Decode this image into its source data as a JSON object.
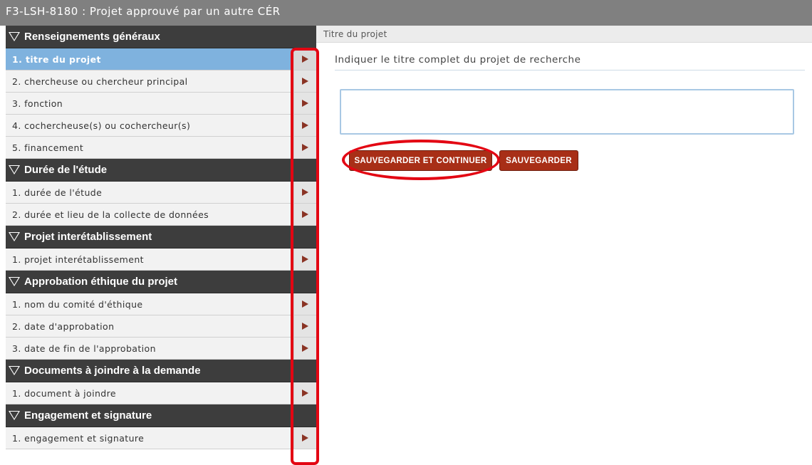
{
  "window": {
    "title": "F3-LSH-8180 : Projet approuvé par un autre CÉR"
  },
  "sidebar": {
    "sections": [
      {
        "title": "Renseignements généraux",
        "items": [
          {
            "label": "1. titre du projet",
            "active": true
          },
          {
            "label": "2. chercheuse ou chercheur principal"
          },
          {
            "label": "3. fonction"
          },
          {
            "label": "4. cochercheuse(s) ou cochercheur(s)"
          },
          {
            "label": "5. financement"
          }
        ]
      },
      {
        "title": "Durée de l'étude",
        "items": [
          {
            "label": "1. durée de l'étude"
          },
          {
            "label": "2. durée et lieu de la collecte de données"
          }
        ]
      },
      {
        "title": "Projet interétablissement",
        "items": [
          {
            "label": "1. projet interétablissement"
          }
        ]
      },
      {
        "title": "Approbation éthique du projet",
        "items": [
          {
            "label": "1. nom du comité d'éthique"
          },
          {
            "label": "2. date d'approbation"
          },
          {
            "label": "3. date de fin de l'approbation"
          }
        ]
      },
      {
        "title": "Documents à joindre à la demande",
        "items": [
          {
            "label": "1. document à joindre"
          }
        ]
      },
      {
        "title": "Engagement et signature",
        "items": [
          {
            "label": "1. engagement et signature"
          }
        ]
      }
    ]
  },
  "content": {
    "header": "Titre du projet",
    "question": "Indiquer le titre complet du projet de recherche",
    "input_value": "",
    "buttons": {
      "save_continue": "SAUVEGARDER ET CONTINUER",
      "save": "SAUVEGARDER"
    }
  },
  "colors": {
    "titlebar": "#808080",
    "section_header": "#3d3d3d",
    "active_item": "#7fb2de",
    "button": "#a82f17",
    "annotation": "#e30613",
    "arrow": "#8a3324"
  },
  "icons": {
    "section_toggle": "triangle-down-outline-icon",
    "item_arrow": "play-arrow-icon"
  }
}
